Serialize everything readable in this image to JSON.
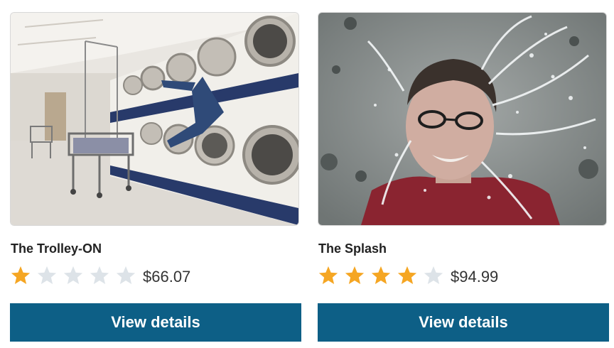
{
  "products": [
    {
      "name": "The Trolley-ON",
      "image": "laundromat-photo",
      "rating": 1,
      "max_rating": 5,
      "price": "$66.07",
      "button_label": "View details"
    },
    {
      "name": "The Splash",
      "image": "water-splash-photo",
      "rating": 4,
      "max_rating": 5,
      "price": "$94.99",
      "button_label": "View details"
    }
  ],
  "colors": {
    "star_filled": "#f5a623",
    "star_empty": "#dde3e8",
    "button_bg": "#0d5f86",
    "button_text": "#ffffff"
  }
}
